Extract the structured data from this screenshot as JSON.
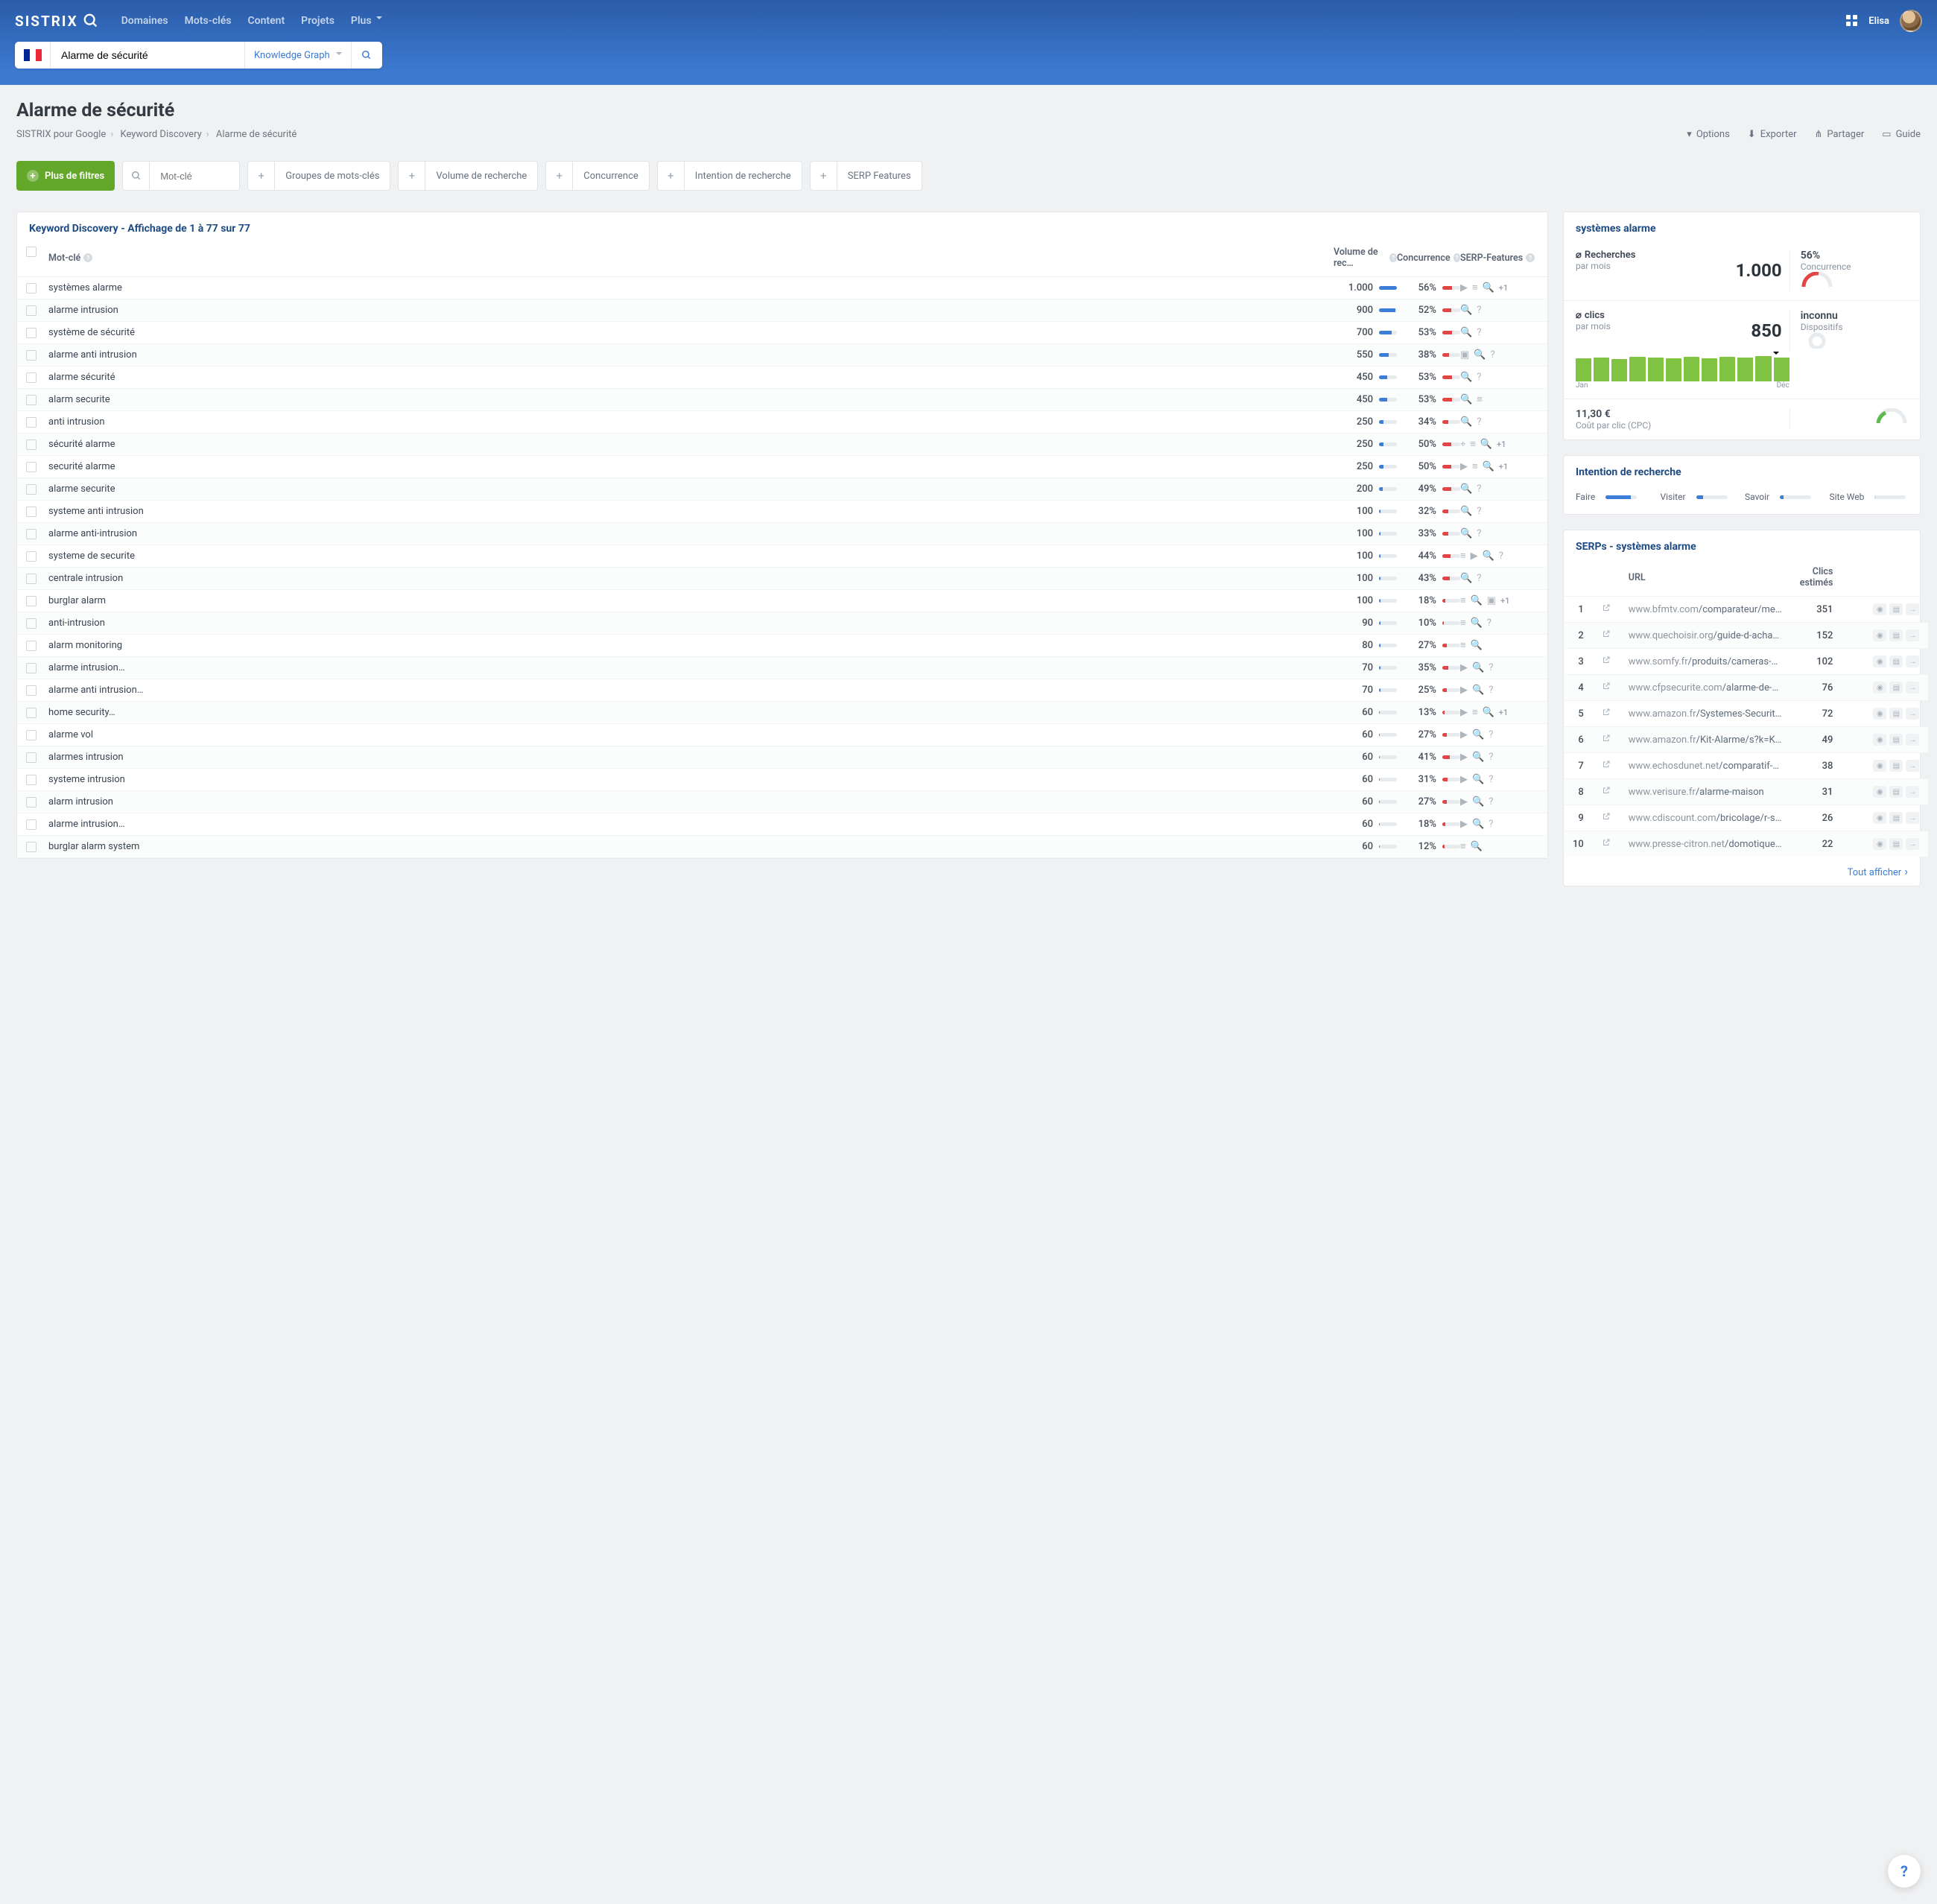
{
  "brand": "SISTRIX",
  "nav": {
    "items": [
      "Domaines",
      "Mots-clés",
      "Content",
      "Projets",
      "Plus"
    ]
  },
  "user": {
    "name": "Elisa"
  },
  "search": {
    "value": "Alarme de sécurité",
    "dropdown": "Knowledge Graph"
  },
  "page": {
    "title": "Alarme de sécurité",
    "crumbs": [
      "SISTRIX pour Google",
      "Keyword Discovery",
      "Alarme de sécurité"
    ]
  },
  "actions": {
    "options": "Options",
    "export": "Exporter",
    "share": "Partager",
    "guide": "Guide"
  },
  "filters": {
    "more": "Plus de filtres",
    "keyword_ph": "Mot-clé",
    "groups": "Groupes de mots-clés",
    "volume": "Volume de recherche",
    "competition": "Concurrence",
    "intent": "Intention de recherche",
    "serp": "SERP Features"
  },
  "table": {
    "title": "Keyword Discovery - Affichage de 1 à 77 sur 77",
    "cols": {
      "kw": "Mot-clé",
      "vol": "Volume de rec…",
      "comp": "Concurrence",
      "feat": "SERP-Features"
    },
    "rows": [
      {
        "kw": "systèmes alarme",
        "vol": "1.000",
        "vbar": 100,
        "comp": "56%",
        "cbar": 56,
        "feats": [
          "video",
          "lines",
          "mag"
        ],
        "plus": "+1"
      },
      {
        "kw": "alarme intrusion",
        "vol": "900",
        "vbar": 90,
        "comp": "52%",
        "cbar": 52,
        "feats": [
          "mag",
          "q"
        ]
      },
      {
        "kw": "système de sécurité",
        "vol": "700",
        "vbar": 70,
        "comp": "53%",
        "cbar": 53,
        "feats": [
          "mag",
          "q"
        ]
      },
      {
        "kw": "alarme anti intrusion",
        "vol": "550",
        "vbar": 55,
        "comp": "38%",
        "cbar": 38,
        "feats": [
          "img",
          "mag",
          "q"
        ]
      },
      {
        "kw": "alarme sécurité",
        "vol": "450",
        "vbar": 45,
        "comp": "53%",
        "cbar": 53,
        "feats": [
          "mag",
          "q"
        ]
      },
      {
        "kw": "alarm securite",
        "vol": "450",
        "vbar": 45,
        "comp": "53%",
        "cbar": 53,
        "feats": [
          "mag",
          "lines"
        ]
      },
      {
        "kw": "anti intrusion",
        "vol": "250",
        "vbar": 25,
        "comp": "34%",
        "cbar": 34,
        "feats": [
          "mag",
          "q"
        ]
      },
      {
        "kw": "sécurité alarme",
        "vol": "250",
        "vbar": 25,
        "comp": "50%",
        "cbar": 50,
        "feats": [
          "local",
          "lines",
          "mag"
        ],
        "plus": "+1"
      },
      {
        "kw": "securité alarme",
        "vol": "250",
        "vbar": 25,
        "comp": "50%",
        "cbar": 50,
        "feats": [
          "video",
          "lines",
          "mag"
        ],
        "plus": "+1"
      },
      {
        "kw": "alarme securite",
        "vol": "200",
        "vbar": 20,
        "comp": "49%",
        "cbar": 49,
        "feats": [
          "mag",
          "q"
        ]
      },
      {
        "kw": "systeme anti intrusion",
        "vol": "100",
        "vbar": 10,
        "comp": "32%",
        "cbar": 32,
        "feats": [
          "mag",
          "q"
        ]
      },
      {
        "kw": "alarme anti-intrusion",
        "vol": "100",
        "vbar": 10,
        "comp": "33%",
        "cbar": 33,
        "feats": [
          "mag",
          "q"
        ]
      },
      {
        "kw": "systeme de securite",
        "vol": "100",
        "vbar": 10,
        "comp": "44%",
        "cbar": 44,
        "feats": [
          "lines",
          "video",
          "mag",
          "q"
        ]
      },
      {
        "kw": "centrale intrusion",
        "vol": "100",
        "vbar": 10,
        "comp": "43%",
        "cbar": 43,
        "feats": [
          "mag",
          "q"
        ]
      },
      {
        "kw": "burglar alarm",
        "vol": "100",
        "vbar": 10,
        "comp": "18%",
        "cbar": 18,
        "feats": [
          "lines",
          "mag",
          "img"
        ],
        "plus": "+1"
      },
      {
        "kw": "anti-intrusion",
        "vol": "90",
        "vbar": 9,
        "comp": "10%",
        "cbar": 10,
        "feats": [
          "lines",
          "mag",
          "q"
        ]
      },
      {
        "kw": "alarm monitoring",
        "vol": "80",
        "vbar": 8,
        "comp": "27%",
        "cbar": 27,
        "feats": [
          "lines",
          "mag"
        ]
      },
      {
        "kw": "alarme intrusion…",
        "vol": "70",
        "vbar": 7,
        "comp": "35%",
        "cbar": 35,
        "feats": [
          "video",
          "mag",
          "q"
        ]
      },
      {
        "kw": "alarme anti intrusion…",
        "vol": "70",
        "vbar": 7,
        "comp": "25%",
        "cbar": 25,
        "feats": [
          "video",
          "mag",
          "q"
        ]
      },
      {
        "kw": "home security…",
        "vol": "60",
        "vbar": 6,
        "comp": "13%",
        "cbar": 13,
        "feats": [
          "video",
          "lines",
          "mag"
        ],
        "plus": "+1"
      },
      {
        "kw": "alarme vol",
        "vol": "60",
        "vbar": 6,
        "comp": "27%",
        "cbar": 27,
        "feats": [
          "video",
          "mag",
          "q"
        ]
      },
      {
        "kw": "alarmes intrusion",
        "vol": "60",
        "vbar": 6,
        "comp": "41%",
        "cbar": 41,
        "feats": [
          "video",
          "mag",
          "q"
        ]
      },
      {
        "kw": "systeme intrusion",
        "vol": "60",
        "vbar": 6,
        "comp": "31%",
        "cbar": 31,
        "feats": [
          "video",
          "mag",
          "q"
        ]
      },
      {
        "kw": "alarm intrusion",
        "vol": "60",
        "vbar": 6,
        "comp": "27%",
        "cbar": 27,
        "feats": [
          "video",
          "mag",
          "q"
        ]
      },
      {
        "kw": "alarme intrusion…",
        "vol": "60",
        "vbar": 6,
        "comp": "18%",
        "cbar": 18,
        "feats": [
          "video",
          "mag",
          "q"
        ]
      },
      {
        "kw": "burglar alarm system",
        "vol": "60",
        "vbar": 6,
        "comp": "12%",
        "cbar": 12,
        "feats": [
          "lines",
          "mag"
        ]
      }
    ]
  },
  "metrics": {
    "title": "systèmes alarme",
    "searches": {
      "label": "Recherches",
      "sub": "par mois",
      "value": "1.000",
      "right_val": "56%",
      "right_lbl": "Concurrence"
    },
    "clicks": {
      "label": "clics",
      "sub": "par mois",
      "value": "850",
      "right_val": "inconnu",
      "right_lbl": "Dispositifs",
      "xmin": "Jan",
      "xmax": "Déc"
    },
    "bars": [
      92,
      95,
      88,
      97,
      94,
      90,
      96,
      91,
      98,
      95,
      100,
      93
    ],
    "cpc": {
      "value": "11,30 €",
      "label": "Coût par clic (CPC)"
    }
  },
  "intent": {
    "title": "Intention de recherche",
    "items": [
      {
        "label": "Faire",
        "pct": 80,
        "color": "#3b7dd9"
      },
      {
        "label": "Visiter",
        "pct": 22,
        "color": "#3b7dd9"
      },
      {
        "label": "Savoir",
        "pct": 12,
        "color": "#3b7dd9"
      },
      {
        "label": "Site Web",
        "pct": 5,
        "color": "#cfd5db"
      }
    ]
  },
  "serps": {
    "title": "SERPs - systèmes alarme",
    "cols": {
      "url": "URL",
      "clicks": "Clics estimés"
    },
    "rows": [
      {
        "rank": "1",
        "dom": "www.bfmtv.com",
        "path": "/comparateur/meilleu…",
        "clicks": "351",
        "bar": 100
      },
      {
        "rank": "2",
        "dom": "www.quechoisir.org",
        "path": "/guide-d-achat-alar…",
        "clicks": "152",
        "bar": 43
      },
      {
        "rank": "3",
        "dom": "www.somfy.fr",
        "path": "/produits/cameras-et-ala…",
        "clicks": "102",
        "bar": 29
      },
      {
        "rank": "4",
        "dom": "www.cfpsecurite.com",
        "path": "/alarme-de-mais…",
        "clicks": "76",
        "bar": 22
      },
      {
        "rank": "5",
        "dom": "www.amazon.fr",
        "path": "/Systemes-Securite-M…",
        "clicks": "72",
        "bar": 21
      },
      {
        "rank": "6",
        "dom": "www.amazon.fr",
        "path": "/Kit-Alarme/s?k=Kit+Al…",
        "clicks": "49",
        "bar": 14
      },
      {
        "rank": "7",
        "dom": "www.echosdunet.net",
        "path": "/comparatif-alar…",
        "clicks": "38",
        "bar": 11
      },
      {
        "rank": "8",
        "dom": "www.verisure.fr",
        "path": "/alarme-maison",
        "clicks": "31",
        "bar": 9
      },
      {
        "rank": "9",
        "dom": "www.cdiscount.com",
        "path": "/bricolage/r-syste…",
        "clicks": "26",
        "bar": 7
      },
      {
        "rank": "10",
        "dom": "www.presse-citron.net",
        "path": "/domotique/alar…",
        "clicks": "22",
        "bar": 6
      }
    ],
    "showall": "Tout afficher"
  }
}
